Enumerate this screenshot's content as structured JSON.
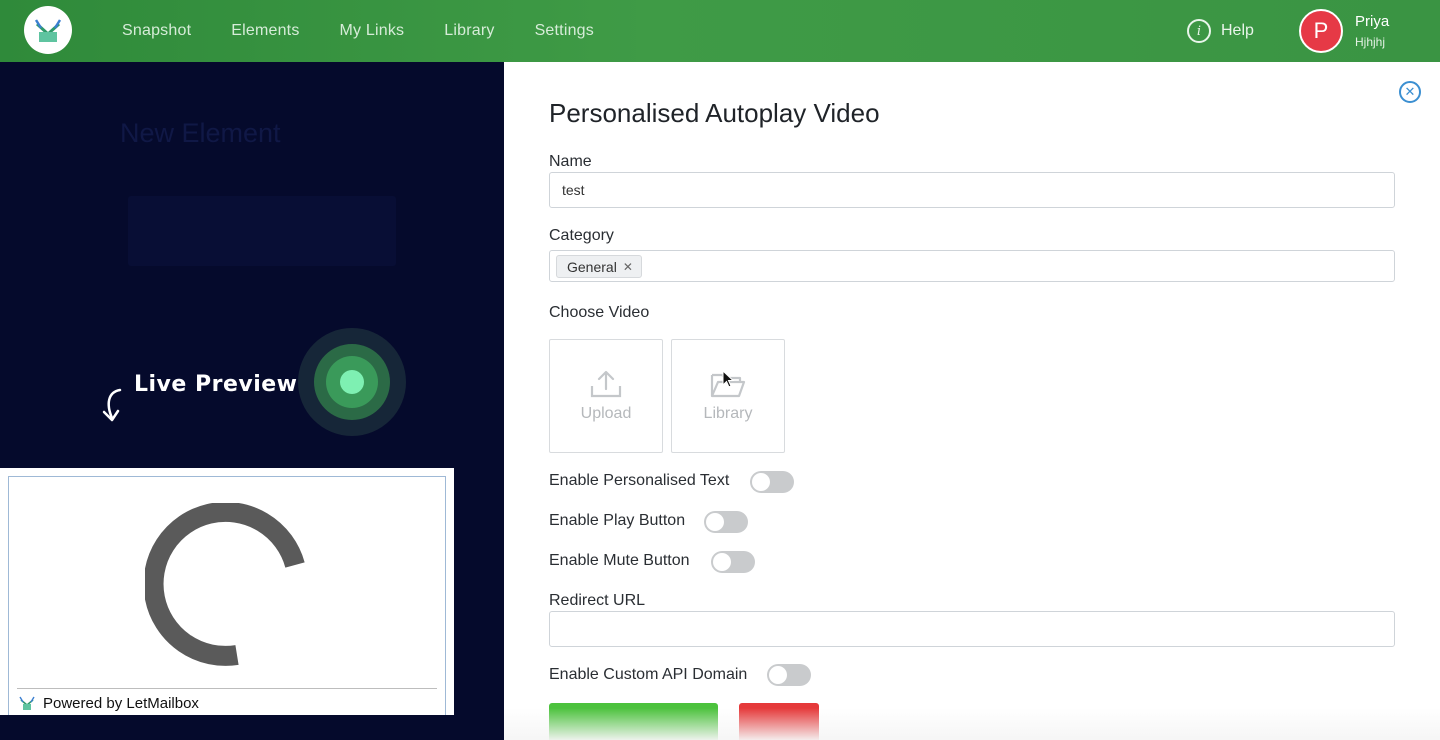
{
  "nav": {
    "items": [
      "Snapshot",
      "Elements",
      "My Links",
      "Library",
      "Settings"
    ],
    "help_label": "Help",
    "help_icon": "info-icon"
  },
  "user": {
    "initial": "P",
    "name": "Priya",
    "subtitle": "Hjhjhj"
  },
  "background": {
    "title": "New Element"
  },
  "preview": {
    "live_label": "Live Preview",
    "powered_by": "Powered by LetMailbox"
  },
  "form": {
    "title": "Personalised Autoplay Video",
    "name_label": "Name",
    "name_value": "test",
    "category_label": "Category",
    "category_tag": "General",
    "choose_video_label": "Choose Video",
    "upload_label": "Upload",
    "library_label": "Library",
    "toggles": [
      {
        "label": "Enable Personalised Text",
        "on": false
      },
      {
        "label": "Enable Play Button",
        "on": false
      },
      {
        "label": "Enable Mute Button",
        "on": false
      }
    ],
    "redirect_label": "Redirect URL",
    "redirect_value": "",
    "custom_api_label": "Enable Custom API Domain",
    "custom_api_on": false
  },
  "colors": {
    "nav_green": "#3a9443",
    "overlay": "#050a2c",
    "save_green": "#4cc23d",
    "delete_red": "#e5393a",
    "avatar_red": "#e63946",
    "accent_blue": "#3b8fd1"
  }
}
